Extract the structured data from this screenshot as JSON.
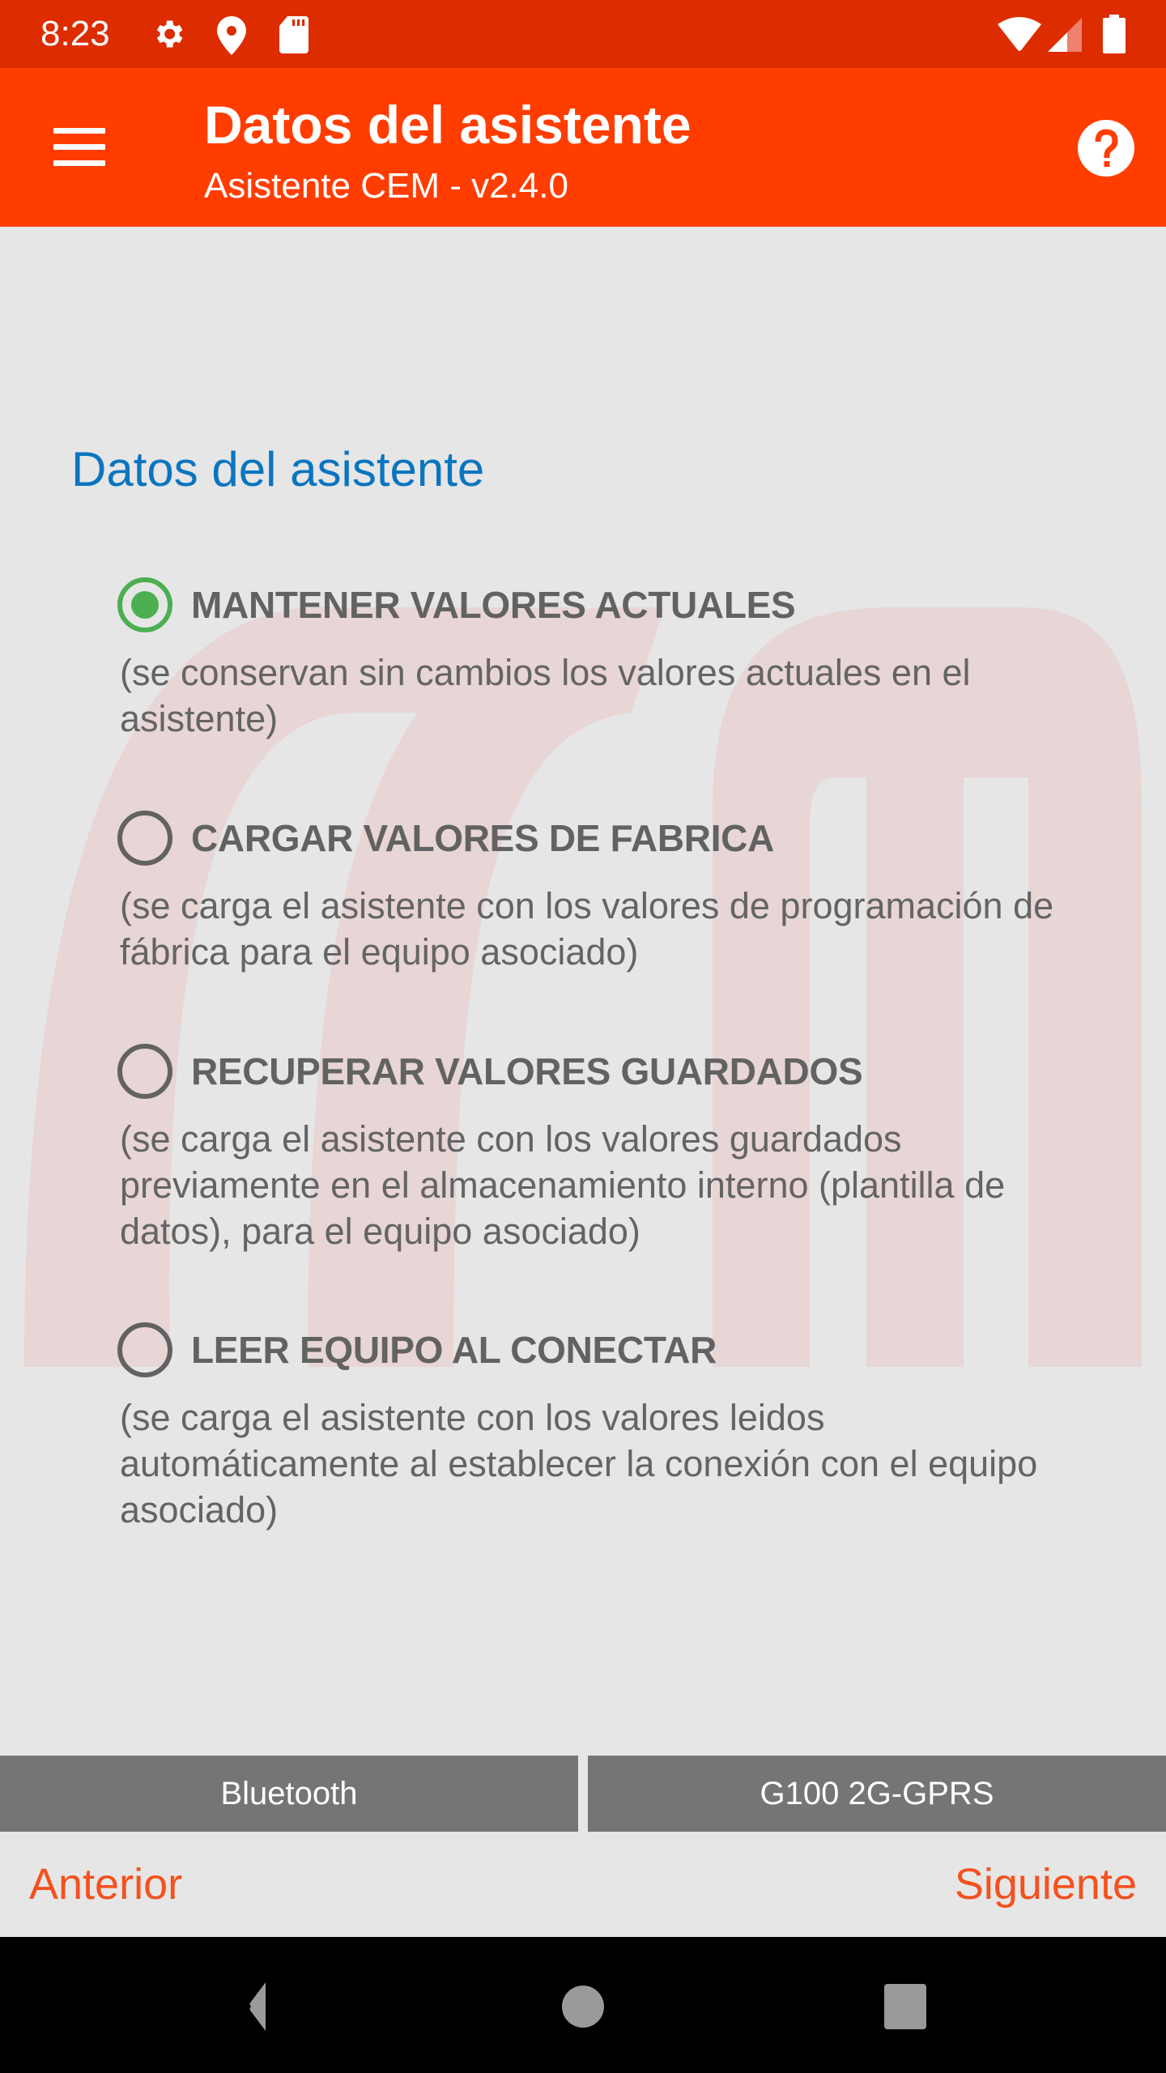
{
  "status_bar": {
    "time": "8:23",
    "left_icons": [
      "gear-icon",
      "location-pin-icon",
      "sd-card-icon"
    ],
    "right_icons": [
      "wifi-icon",
      "cell-signal-icon",
      "battery-icon"
    ]
  },
  "app_bar": {
    "title": "Datos del asistente",
    "subtitle": "Asistente CEM - v2.4.0",
    "menu_icon": "hamburger-menu-icon",
    "help_icon": "help-circle-icon",
    "background_color": "#ff3d00"
  },
  "main": {
    "section_title": "Datos del asistente",
    "watermark_text": "cem",
    "selected_index": 0,
    "options": [
      {
        "label": "MANTENER VALORES ACTUALES",
        "description": "(se conservan sin cambios los valores actuales en el asistente)",
        "selected": true
      },
      {
        "label": "CARGAR VALORES DE FABRICA",
        "description": "(se carga el asistente con los valores de programación de fábrica para el equipo asociado)",
        "selected": false
      },
      {
        "label": "RECUPERAR VALORES GUARDADOS",
        "description": "(se carga el asistente con los valores guardados previamente en el almacenamiento interno (plantilla de datos), para el equipo asociado)",
        "selected": false
      },
      {
        "label": "LEER EQUIPO AL CONECTAR",
        "description": "(se carga el asistente con los valores leidos automáticamente al establecer la conexión con el equipo asociado)",
        "selected": false
      }
    ],
    "radio_selected_color": "#4caf50"
  },
  "device_bar": {
    "connection": "Bluetooth",
    "device": "G100 2G-GPRS"
  },
  "navigation": {
    "previous": "Anterior",
    "next": "Siguiente",
    "link_color": "#f4511e"
  },
  "system_nav": {
    "buttons": [
      "back-icon",
      "home-icon",
      "recents-icon"
    ]
  }
}
